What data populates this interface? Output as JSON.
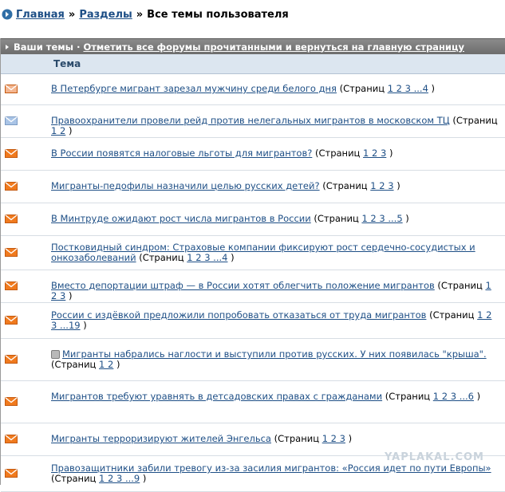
{
  "breadcrumb": {
    "home": "Главная",
    "sections": "Разделы",
    "current": "Все темы пользователя",
    "sep": "»"
  },
  "header": {
    "label": "Ваши темы",
    "dot": "·",
    "mark_all_link": "Отметить все форумы прочитанными и вернуться на главную страницу"
  },
  "column": {
    "topic": "Тема"
  },
  "pages_word": "(Страниц",
  "topics": [
    {
      "title": "В Петербурге мигрант зарезал мужчину среди белого дня",
      "pages": "1 2 3 ...4",
      "icon": "pale"
    },
    {
      "title": "Правоохранители провели рейд против нелегальных мигрантов в московском ТЦ",
      "pages": "1 2",
      "icon": "blue"
    },
    {
      "title": "В России появятся налоговые льготы для мигрантов?",
      "pages": "1 2 3",
      "icon": "orange"
    },
    {
      "title": "Мигранты-педофилы назначили целью русских детей?",
      "pages": "1 2 3",
      "icon": "orange"
    },
    {
      "title": "В Минтруде ожидают рост числа мигрантов в России",
      "pages": "1 2 3 ...5",
      "icon": "orange"
    },
    {
      "title": "Постковидный синдром: Страховые компании фиксируют рост сердечно-сосудистых и онкозаболеваний",
      "pages": "1 2 3 ...4",
      "icon": "orange"
    },
    {
      "title": "Вместо депортации штраф — в России хотят облегчить положение мигрантов",
      "pages": "1 2 3",
      "icon": "orange"
    },
    {
      "title": "России с издёвкой предложили попробовать отказаться от труда мигрантов",
      "pages": "1 2 3 ...19",
      "icon": "orange"
    },
    {
      "title": "Мигранты набрались наглости и выступили против русских. У них появилась \"крыша\".",
      "pages": "1 2",
      "icon": "orange",
      "pinned": true
    },
    {
      "title": "Мигрантов требуют уравнять в детсадовских правах с гражданами",
      "pages": "1 2 3 ...6",
      "icon": "orange"
    },
    {
      "title": "Мигранты терроризируют жителей Энгельса",
      "pages": "1 2 3",
      "icon": "orange"
    },
    {
      "title": "Правозащитники забили тревогу из-за засилия мигрантов: «Россия идет по пути Европы»",
      "pages": "1 2 3 ...9",
      "icon": "orange"
    }
  ],
  "colors": {
    "link": "#1e4f86",
    "header_bg": "#7d7d7d",
    "colhead_bg": "#dce6f0",
    "env_orange": "#f07a1e",
    "env_pale": "#f3b58f",
    "env_blue": "#a9c4e6"
  },
  "watermark": "YAPLAKAL.COM"
}
